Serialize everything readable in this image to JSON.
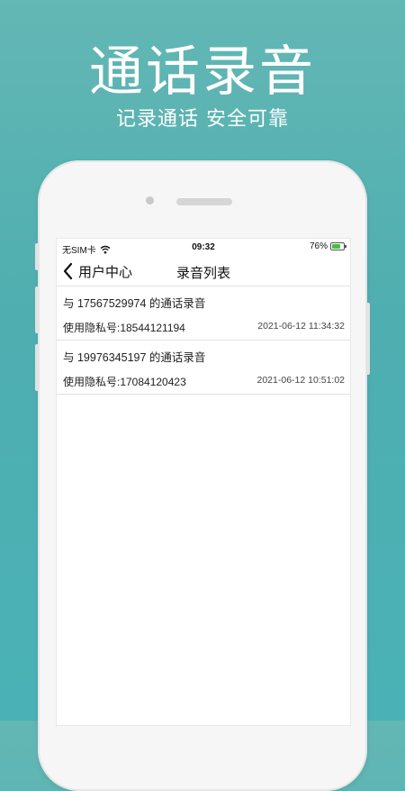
{
  "promo": {
    "title": "通话录音",
    "subtitle": "记录通话 安全可靠"
  },
  "status_bar": {
    "carrier": "无SIM卡",
    "time": "09:32",
    "battery": "76%",
    "battery_level": 0.76,
    "battery_color": "#43c143"
  },
  "nav": {
    "back_label": "用户中心",
    "title": "录音列表"
  },
  "records": [
    {
      "title": "与 17567529974 的通话录音",
      "private_number": "使用隐私号:18544121194",
      "time": "2021-06-12 11:34:32"
    },
    {
      "title": "与 19976345197 的通话录音",
      "private_number": "使用隐私号:17084120423",
      "time": "2021-06-12 10:51:02"
    }
  ],
  "colors": {
    "background": "#58b3b3",
    "screen": "#ffffff",
    "frame": "#f6f6f6"
  }
}
